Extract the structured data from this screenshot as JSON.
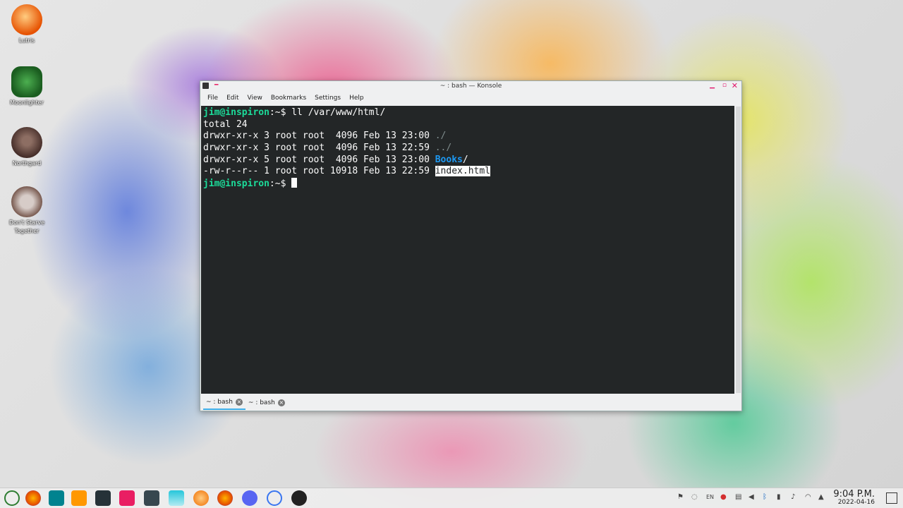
{
  "desktop_icons": [
    {
      "label": "Lutris",
      "icon": "lutris-icon"
    },
    {
      "label": "Moonlighter",
      "icon": "moonlighter-icon"
    },
    {
      "label": "Northgard",
      "icon": "northgard-icon"
    },
    {
      "label": "Don't Starve Together",
      "icon": "dont-starve-together-icon"
    }
  ],
  "window": {
    "title": "~ : bash — Konsole",
    "menu": [
      "File",
      "Edit",
      "View",
      "Bookmarks",
      "Settings",
      "Help"
    ],
    "tabs": [
      "~ : bash",
      "~ : bash"
    ]
  },
  "terminal": {
    "prompt": "jim@inspiron",
    "prompt_path": ":~$",
    "command": " ll /var/www/html/",
    "total": "total 24",
    "entries": [
      {
        "meta": "drwxr-xr-x 3 root root  4096 Feb 13 23:00 ",
        "name": "./"
      },
      {
        "meta": "drwxr-xr-x 3 root root  4096 Feb 13 22:59 ",
        "name": "../"
      },
      {
        "meta": "drwxr-xr-x 5 root root  4096 Feb 13 23:00 ",
        "name": "Books",
        "suffix": "/"
      },
      {
        "meta": "-rw-r--r-- 1 root root 10918 Feb 13 22:59 ",
        "name": "index.html"
      }
    ],
    "prompt2_path": ":~$ "
  },
  "taskbar": {
    "apps": [
      "app-launcher-icon",
      "firefox-icon",
      "media-icon",
      "sublime-icon",
      "terminal-icon",
      "files-icon",
      "konsole-icon",
      "kdenlive-icon",
      "lutris-icon",
      "firefox-icon",
      "discord-icon",
      "signal-icon",
      "obs-icon"
    ],
    "tray_lang": "EN",
    "time": "9:04 P.M.",
    "date": "2022-04-16"
  },
  "colors": {
    "terminal_bg": "#232627",
    "prompt": "#1cdc9a",
    "dir": "#1d99f3",
    "accent": "#e2146a"
  }
}
